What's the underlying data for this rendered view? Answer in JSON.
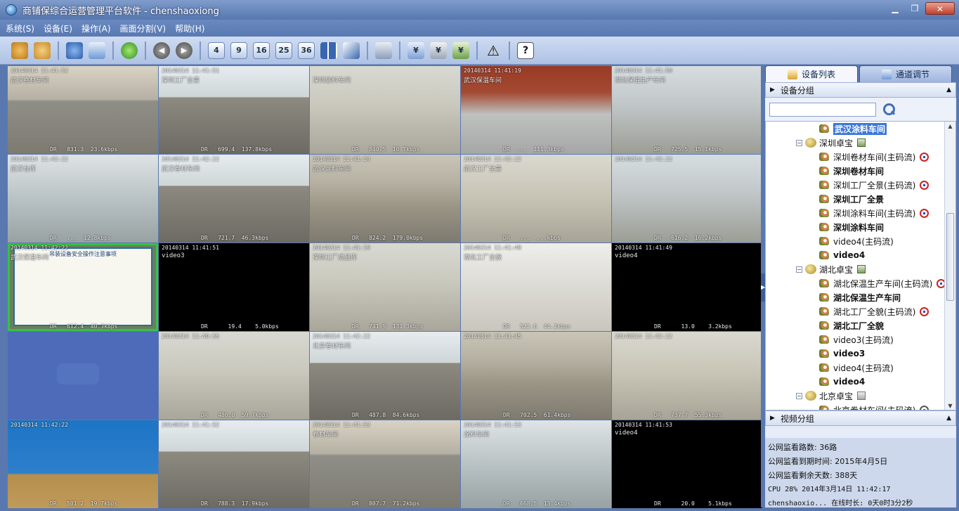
{
  "window": {
    "title": "商铺保综合运营管理平台软件 - chenshaoxiong"
  },
  "menu": [
    "系统(S)",
    "设备(E)",
    "操作(A)",
    "画面分割(V)",
    "帮助(H)"
  ],
  "toolbar": {
    "split_labels": [
      "4",
      "9",
      "16",
      "25",
      "36"
    ]
  },
  "cells": [
    {
      "ts": "20140314  11:41:52",
      "name": "武汉卷材车间",
      "br": "DR   831.3  23.6kbps",
      "scene": "a"
    },
    {
      "ts": "20140314  11:41:51",
      "name": "深圳工厂全景",
      "br": "DR   699.4  137.8kbps",
      "scene": "b"
    },
    {
      "ts": "",
      "name": "深圳涂料车间",
      "br": "DR   840.5  10.7kbps",
      "scene": "c"
    },
    {
      "ts": "20140314  11:41:19",
      "name": "武汉保温车间",
      "br": "DR  ...  111.3kbps",
      "scene": "f"
    },
    {
      "ts": "20140314  11:41:50",
      "name": "湖北保温生产车间",
      "br": "DR   725.5  15.1kbps",
      "scene": "h"
    },
    {
      "ts": "20140314  11:42:22",
      "name": "武汉仓库",
      "br": "DR   ...  12.8kbps",
      "scene": "e"
    },
    {
      "ts": "20140314  11:42:22",
      "name": "武汉卷材车间",
      "br": "DR   721.7  46.3kbps",
      "scene": "b"
    },
    {
      "ts": "20140314  11:41:14",
      "name": "武汉涂料车间",
      "br": "DR   824.2  179.0kbps",
      "scene": "d"
    },
    {
      "ts": "20140314  11:42:22",
      "name": "武汉工厂全景",
      "br": "DR   ...  ...kbps",
      "scene": "g"
    },
    {
      "ts": "20140314  11:42:22",
      "name": "",
      "br": "DR   616.2  16.2kbps",
      "scene": "h"
    },
    {
      "ts": "20140314  11:42:22",
      "name": "武汉保温车间",
      "br": "DR   612.4  40.3kbps",
      "scene": "sign",
      "selected": true
    },
    {
      "ts": "20140314  11:41:51",
      "name": "video3",
      "br": "DR      19.4    5.0kbps",
      "scene": "black"
    },
    {
      "ts": "20140314  11:41:19",
      "name": "深圳工厂成品库",
      "br": "DR   741.9  131.3kbps",
      "scene": "c"
    },
    {
      "ts": "20140314  11:41:49",
      "name": "湖北工厂全貌",
      "br": "DR   522.6  44.2kbps",
      "scene": "j"
    },
    {
      "ts": "20140314  11:41:49",
      "name": "video4",
      "br": "DR      13.0    3.2kbps",
      "scene": "black"
    },
    {
      "ts": "",
      "name": "",
      "br": "",
      "scene": "empty"
    },
    {
      "ts": "20140314  11:40:56",
      "name": "",
      "br": "DR   486.0  59.7kbps",
      "scene": "c"
    },
    {
      "ts": "20140314  11:42:22",
      "name": "北京卷材车间",
      "br": "DR   487.8  84.6kbps",
      "scene": "b"
    },
    {
      "ts": "20140314  11:41:45",
      "name": "",
      "br": "DR   702.5  61.4kbps",
      "scene": "d"
    },
    {
      "ts": "20140314  11:42:22",
      "name": "",
      "br": "DR   737.7  55.3kbps",
      "scene": "g"
    },
    {
      "ts": "20140314  11:42:22",
      "name": "",
      "br": "DR   501.2  19.7kbps",
      "scene": "i"
    },
    {
      "ts": "20140314  11:41:52",
      "name": "",
      "br": "DR   788.3  17.9kbps",
      "scene": "b"
    },
    {
      "ts": "20140314  11:41:53",
      "name": "卷材车间",
      "br": "DR   807.7  71.2kbps",
      "scene": "a"
    },
    {
      "ts": "20140314  11:41:53",
      "name": "涂料车间",
      "br": "DR   668.5  13.4kbps",
      "scene": "e"
    },
    {
      "ts": "20140314  11:41:53",
      "name": "video4",
      "br": "DR      20.0    5.1kbps",
      "scene": "black"
    }
  ],
  "sign": {
    "header": "吊装设备安全操作注意事项"
  },
  "panel": {
    "tab_devices": "设备列表",
    "tab_channels": "通道调节",
    "group_header": "设备分组",
    "video_group_header": "视频分组",
    "search_placeholder": "",
    "tree": [
      {
        "label": "武汉涂料车间",
        "type": "cam",
        "indent": 1,
        "style": "hl"
      },
      {
        "label": "深圳卓宝",
        "type": "grp",
        "indent": 0,
        "mon": "green"
      },
      {
        "label": "深圳卷材车间(主码流)",
        "type": "cam",
        "indent": 1,
        "rec": "red"
      },
      {
        "label": "深圳卷材车间",
        "type": "cam",
        "indent": 1,
        "style": "bold"
      },
      {
        "label": "深圳工厂全景(主码流)",
        "type": "cam",
        "indent": 1,
        "rec": "red"
      },
      {
        "label": "深圳工厂全景",
        "type": "cam",
        "indent": 1,
        "style": "bold"
      },
      {
        "label": "深圳涂料车间(主码流)",
        "type": "cam",
        "indent": 1,
        "rec": "red"
      },
      {
        "label": "深圳涂料车间",
        "type": "cam",
        "indent": 1,
        "style": "bold"
      },
      {
        "label": "video4(主码流)",
        "type": "cam",
        "indent": 1
      },
      {
        "label": "video4",
        "type": "cam",
        "indent": 1,
        "style": "bold"
      },
      {
        "label": "湖北卓宝",
        "type": "grp",
        "indent": 0,
        "mon": "green"
      },
      {
        "label": "湖北保温生产车间(主码流)",
        "type": "cam",
        "indent": 1,
        "rec": "red"
      },
      {
        "label": "湖北保温生产车间",
        "type": "cam",
        "indent": 1,
        "style": "bold"
      },
      {
        "label": "湖北工厂全貌(主码流)",
        "type": "cam",
        "indent": 1,
        "rec": "red"
      },
      {
        "label": "湖北工厂全貌",
        "type": "cam",
        "indent": 1,
        "style": "bold"
      },
      {
        "label": "video3(主码流)",
        "type": "cam",
        "indent": 1
      },
      {
        "label": "video3",
        "type": "cam",
        "indent": 1,
        "style": "bold"
      },
      {
        "label": "video4(主码流)",
        "type": "cam",
        "indent": 1
      },
      {
        "label": "video4",
        "type": "cam",
        "indent": 1,
        "style": "bold"
      },
      {
        "label": "北京卓宝",
        "type": "grp",
        "indent": 0,
        "mon": "gray"
      },
      {
        "label": "北京卷材车间(主码流)",
        "type": "cam",
        "indent": 1,
        "rec": "gray"
      }
    ]
  },
  "status": {
    "channels": "公网监看路数: 36路",
    "expire": "公网监看到期时间: 2015年4月5日",
    "remaining": "公网监看剩余天数: 388天",
    "cpu": "CPU 28%   2014年3月14日 11:42:17",
    "online": "chenshaoxio...  在线时长: 0天0时3分2秒"
  }
}
